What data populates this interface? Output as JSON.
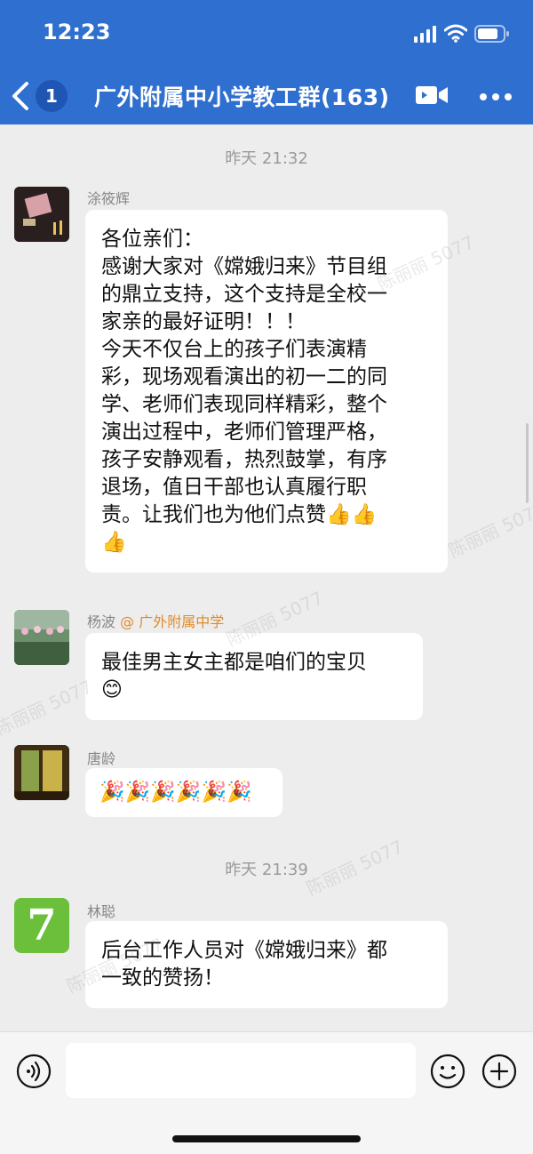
{
  "status_bar": {
    "time": "12:23"
  },
  "header": {
    "unread_count": "1",
    "title": "广外附属中小学教工群(163)"
  },
  "watermark_text": "陈丽丽 5077",
  "messages": [
    {
      "timestamp": "昨天 21:32"
    },
    {
      "sender": "涂筱辉",
      "lines": [
        "各位亲们：",
        "感谢大家对《嫦娥归来》节目组",
        "的鼎立支持，这个支持是全校一",
        "家亲的最好证明！！！",
        "今天不仅台上的孩子们表演精",
        "彩，现场观看演出的初一二的同",
        "学、老师们表现同样精彩，整个",
        "演出过程中，老师们管理严格，",
        "孩子安静观看，热烈鼓掌，有序",
        "退场，值日干部也认真履行职",
        "责。让我们也为他们点赞👍👍",
        "👍"
      ]
    },
    {
      "sender": "杨波",
      "mention": "@ 广外附属中学",
      "lines": [
        "最佳男主女主都是咱们的宝贝",
        "😊"
      ]
    },
    {
      "sender": "唐龄",
      "lines": [
        "🎉🎉🎉🎉🎉🎉"
      ]
    },
    {
      "timestamp": "昨天 21:39"
    },
    {
      "sender": "林聪",
      "avatar_text": "7",
      "lines": [
        "后台工作人员对《嫦娥归来》都",
        "一致的赞扬！"
      ]
    }
  ],
  "colors": {
    "header_bg": "#2f6fcf",
    "chat_bg": "#ededed",
    "mention": "#e08a2a",
    "avatar_green": "#6cbf3a"
  },
  "icons": [
    "back-arrow-icon",
    "video-call-icon",
    "more-icon",
    "voice-icon",
    "emoji-icon",
    "plus-icon",
    "signal-icon",
    "wifi-icon",
    "battery-icon"
  ]
}
